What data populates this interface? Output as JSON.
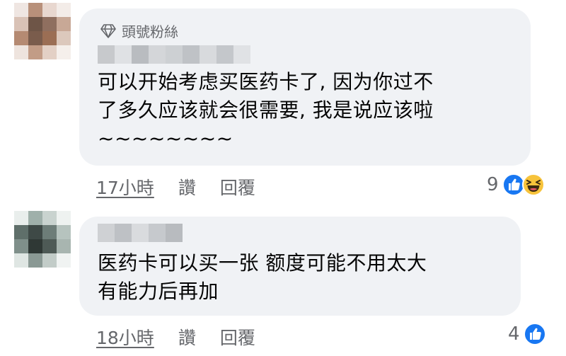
{
  "comments": [
    {
      "badge": "頭號粉絲",
      "text": "可以开始考虑买医药卡了, 因为你过不\n了多久应该就会很需要, 我是说应该啦\n~~~~~~~~",
      "time": "17小時",
      "like_label": "讚",
      "reply_label": "回覆",
      "reaction_count": "9",
      "reactions": [
        "like-icon",
        "haha-icon"
      ]
    },
    {
      "text": "医药卡可以买一张 额度可能不用太大\n有能力后再加",
      "time": "18小時",
      "like_label": "讚",
      "reply_label": "回覆",
      "reaction_count": "4",
      "reactions": [
        "like-icon"
      ]
    }
  ],
  "colors": {
    "bubble": "#f0f2f5",
    "meta_text": "#65676b",
    "like_blue": "#1877f2",
    "haha_yellow": "#f7c33b"
  }
}
